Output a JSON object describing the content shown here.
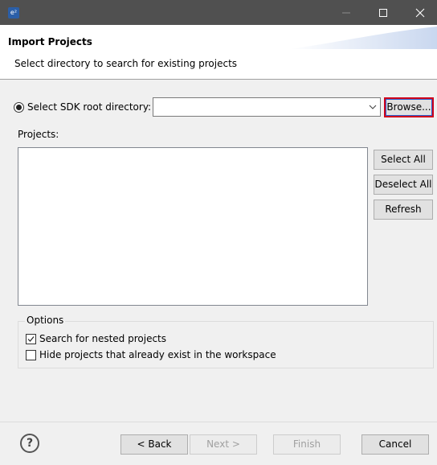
{
  "window": {
    "app_icon_text": "e²",
    "icons": {
      "minimize": "minimize-icon",
      "maximize": "maximize-icon",
      "close": "close-icon"
    }
  },
  "header": {
    "title": "Import Projects",
    "description": "Select directory to search for existing projects"
  },
  "source": {
    "radio_label": "Select SDK root directory:",
    "path_value": "",
    "browse_label": "Browse..."
  },
  "projects": {
    "label": "Projects:",
    "items": [],
    "select_all_label": "Select All",
    "deselect_all_label": "Deselect All",
    "refresh_label": "Refresh"
  },
  "options": {
    "legend": "Options",
    "nested": {
      "label": "Search for nested projects",
      "checked": true
    },
    "hide_existing": {
      "label": "Hide projects that already exist in the workspace",
      "checked": false
    }
  },
  "footer": {
    "back_label": "< Back",
    "next_label": "Next >",
    "finish_label": "Finish",
    "cancel_label": "Cancel"
  },
  "colors": {
    "titlebar": "#505050",
    "highlight_border": "#d0021b",
    "focus_ring": "#2a5fcf"
  }
}
